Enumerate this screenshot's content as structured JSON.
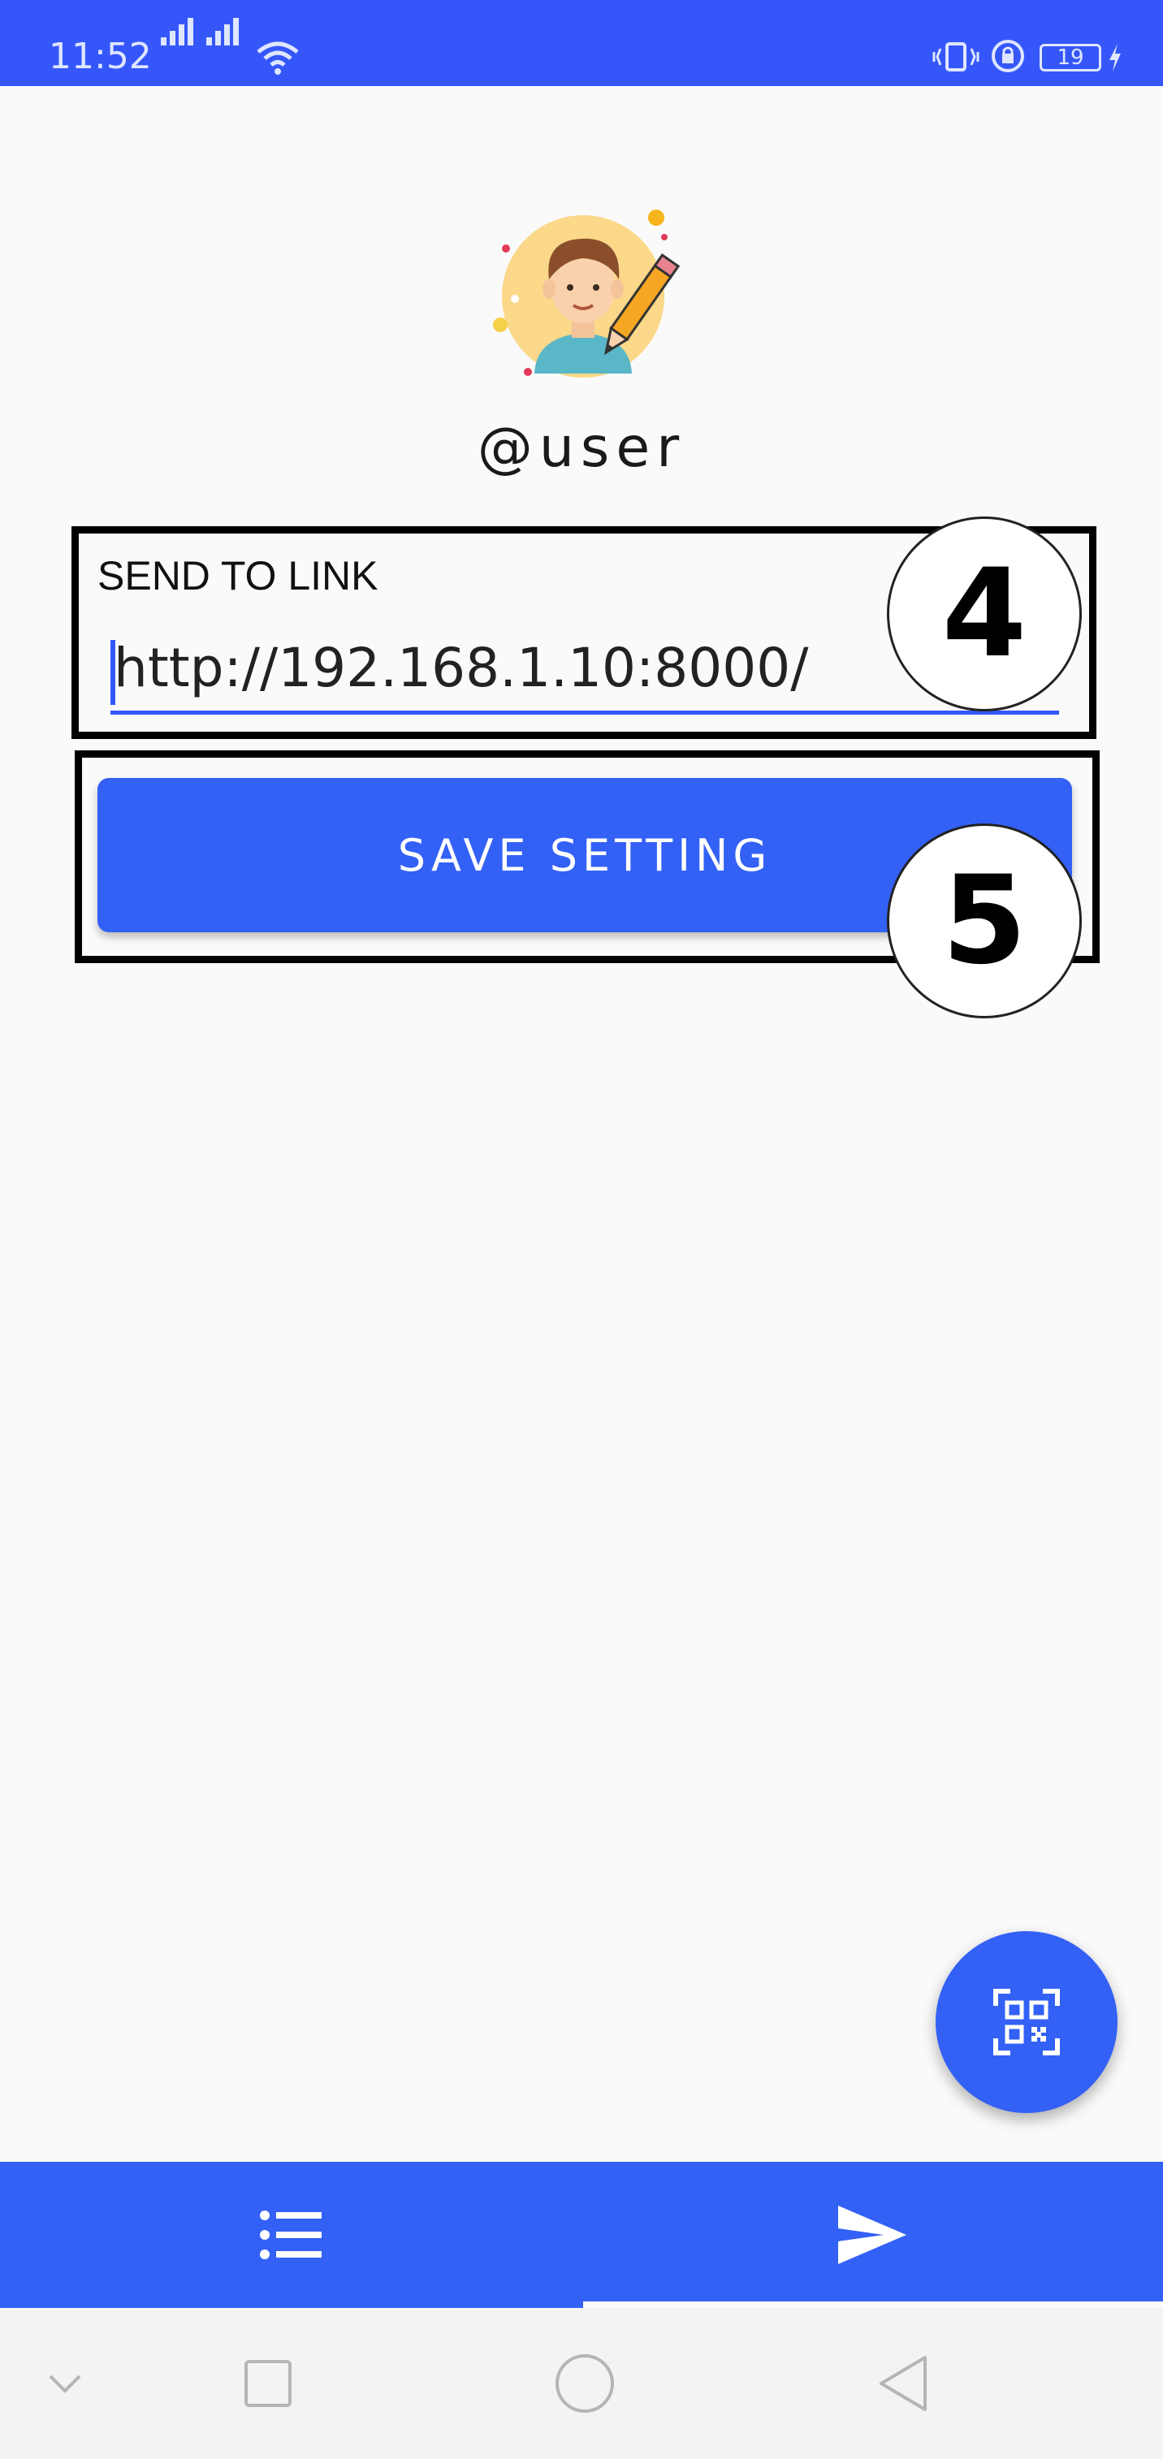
{
  "status_bar": {
    "time": "11:52",
    "battery": "19",
    "icons": [
      "signal-icon",
      "signal-icon",
      "wifi-icon",
      "vibrate-icon",
      "alarm-icon",
      "battery-icon",
      "charging-icon"
    ]
  },
  "profile": {
    "avatar_icon": "avatar-pencil-icon",
    "username": "@user"
  },
  "form": {
    "label": "SEND TO LINK",
    "value": "http://192.168.1.10:8000/",
    "save_label": "SAVE SETTING"
  },
  "annotations": {
    "badge_4": "4",
    "badge_5": "5"
  },
  "fab": {
    "icon": "qr-scan-icon"
  },
  "bottom_nav": {
    "tabs": [
      {
        "icon": "list-icon",
        "active": false
      },
      {
        "icon": "send-icon",
        "active": true
      }
    ]
  },
  "system_nav": {
    "icons": [
      "chevron-down-icon",
      "recents-icon",
      "home-icon",
      "back-icon"
    ]
  },
  "colors": {
    "primary": "#3361f6",
    "status_bar": "#3557fa",
    "background": "#fafafa"
  }
}
